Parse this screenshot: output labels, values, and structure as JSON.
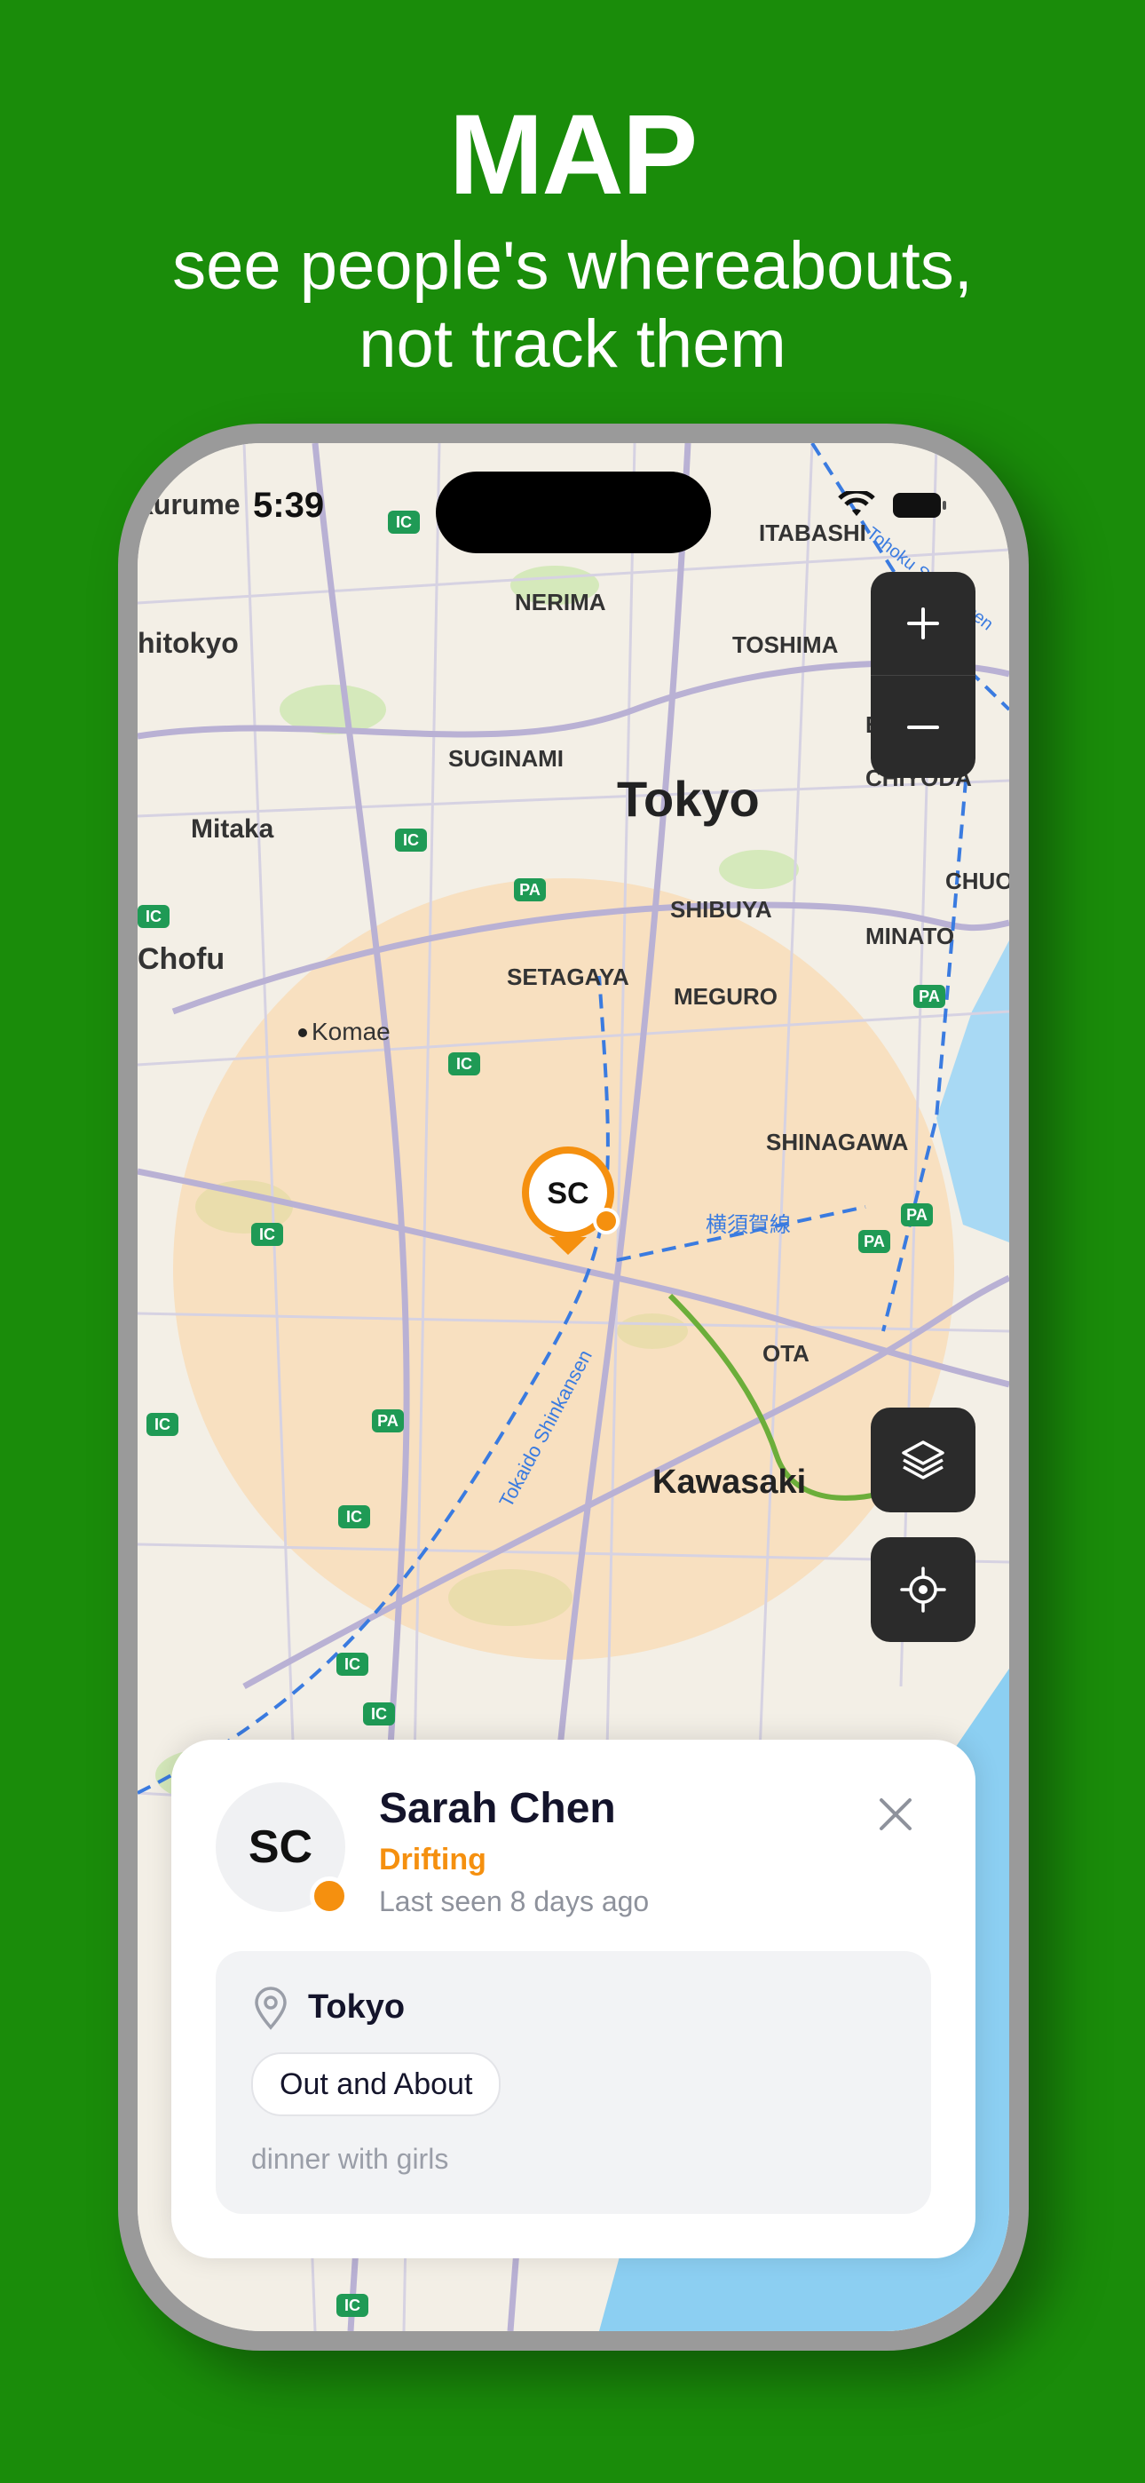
{
  "headline": {
    "title": "MAP",
    "subtitle_line1": "see people's whereabouts,",
    "subtitle_line2": "not track them"
  },
  "status_bar": {
    "time": "5:39",
    "left_place": "kurume",
    "icons": [
      "wifi-icon",
      "battery-icon"
    ]
  },
  "map": {
    "city_label": "Tokyo",
    "labels": [
      "ITABASHI",
      "NERIMA",
      "TOSHIMA",
      "hitokyo",
      "BUNKYO",
      "CHIYODA",
      "SUGINAMI",
      "Mitaka",
      "CHUO",
      "SHIBUYA",
      "MINATO",
      "Chofu",
      "SETAGAYA",
      "MEGURO",
      "Komae",
      "SHINAGAWA",
      "横須賀線",
      "OTA",
      "Tokaido Shinkansen",
      "Kawasaki",
      "Tohoku Shinkansen"
    ],
    "road_badges": [
      "IC",
      "PA"
    ],
    "colors": {
      "radius_fill": "#fbd3a1",
      "water": "#8ccff2",
      "land": "#f3efe6",
      "park": "#cfe8b3",
      "road": "#c8c4d8"
    }
  },
  "controls": {
    "zoom_in": "+",
    "zoom_out": "–",
    "layers_icon": "layers-icon",
    "locate_icon": "crosshair-icon"
  },
  "pin": {
    "initials": "SC",
    "status_color": "#f5900f",
    "ring_color": "#f5900f"
  },
  "sheet": {
    "initials": "SC",
    "name": "Sarah Chen",
    "state": "Drifting",
    "last_seen": "Last seen 8 days ago",
    "location": "Tokyo",
    "activity": "Out and About",
    "note": "dinner with girls",
    "accent_color": "#f5900f"
  }
}
